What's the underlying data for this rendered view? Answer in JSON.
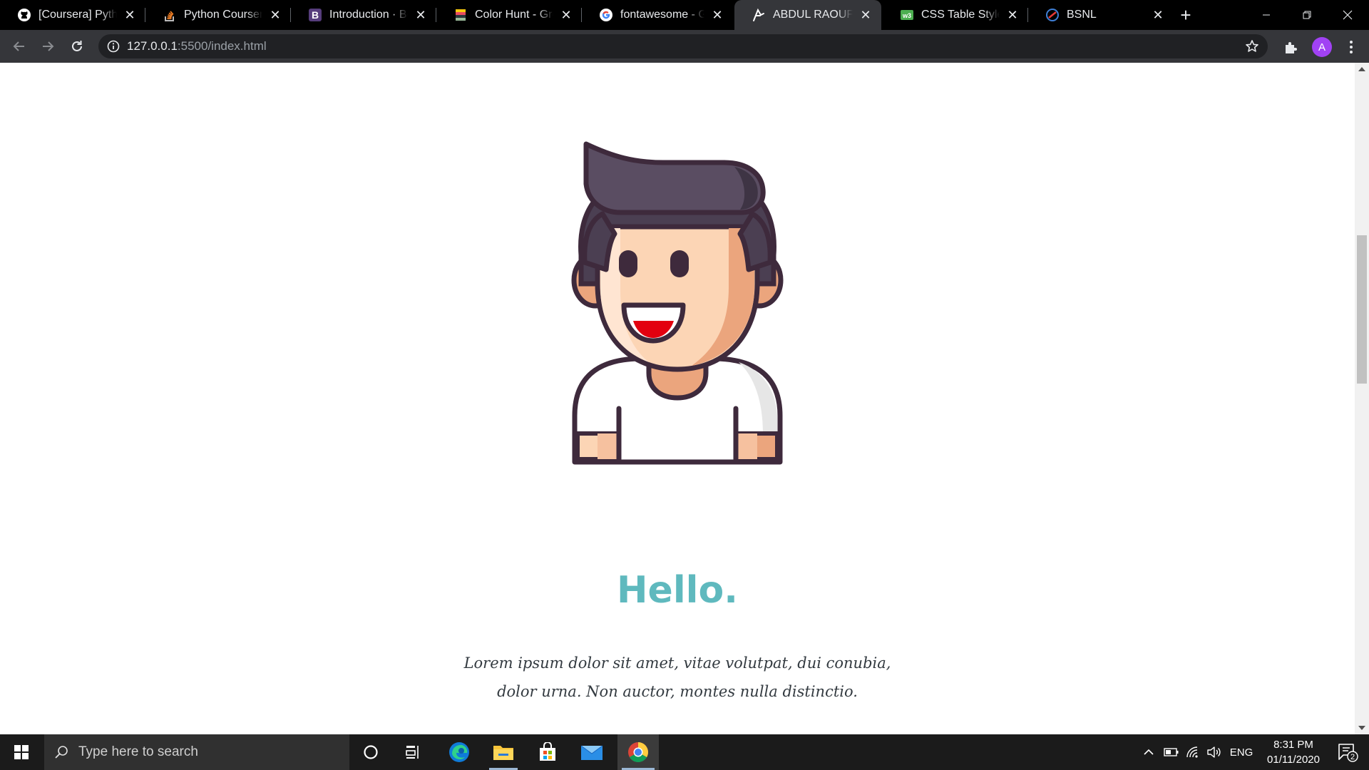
{
  "tabs": [
    {
      "title": "[Coursera] Python",
      "icon": "github-icon",
      "active": false
    },
    {
      "title": "Python Coursera A",
      "icon": "stackoverflow-icon",
      "active": false
    },
    {
      "title": "Introduction · Boot",
      "icon": "bootstrap-icon",
      "active": false
    },
    {
      "title": "Color Hunt - Grey",
      "icon": "colorhunt-icon",
      "active": false
    },
    {
      "title": "fontawesome - Go",
      "icon": "google-icon",
      "active": false
    },
    {
      "title": "ABDUL RAOUF",
      "icon": "signature-icon",
      "active": true
    },
    {
      "title": "CSS Table Style",
      "icon": "w3-icon",
      "active": false
    },
    {
      "title": "BSNL",
      "icon": "bsnl-icon",
      "active": false
    }
  ],
  "address_bar": {
    "host": "127.0.0.1",
    "path": ":5500/index.html"
  },
  "profile": {
    "initial": "A",
    "color": "#a142f4"
  },
  "page": {
    "heading": "Hello.",
    "paragraph_line1": "Lorem ipsum dolor sit amet, vitae volutpat, dui conubia,",
    "paragraph_line2": "dolor urna. Non auctor, montes nulla distinctio.",
    "accent_color": "#5fb9be"
  },
  "taskbar": {
    "search_placeholder": "Type here to search",
    "language": "ENG",
    "time": "8:31 PM",
    "date": "01/11/2020",
    "notification_count": "2"
  }
}
